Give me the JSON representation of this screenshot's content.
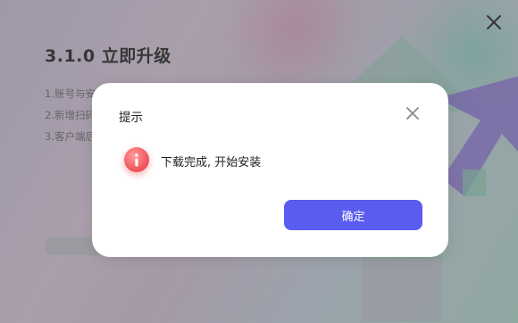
{
  "window": {
    "close_icon": "close-icon"
  },
  "upgrade": {
    "title": "3.1.0 立即升级",
    "notes": [
      "1.账号与安",
      "2.新增扫码",
      "3.客户端后"
    ],
    "progress": 0
  },
  "dialog": {
    "title": "提示",
    "close_icon": "close-icon",
    "status_icon": "info-icon",
    "message": "下载完成, 开始安装",
    "confirm_label": "确定"
  },
  "colors": {
    "accent": "#5a5cf0",
    "alert": "#f04f57"
  }
}
